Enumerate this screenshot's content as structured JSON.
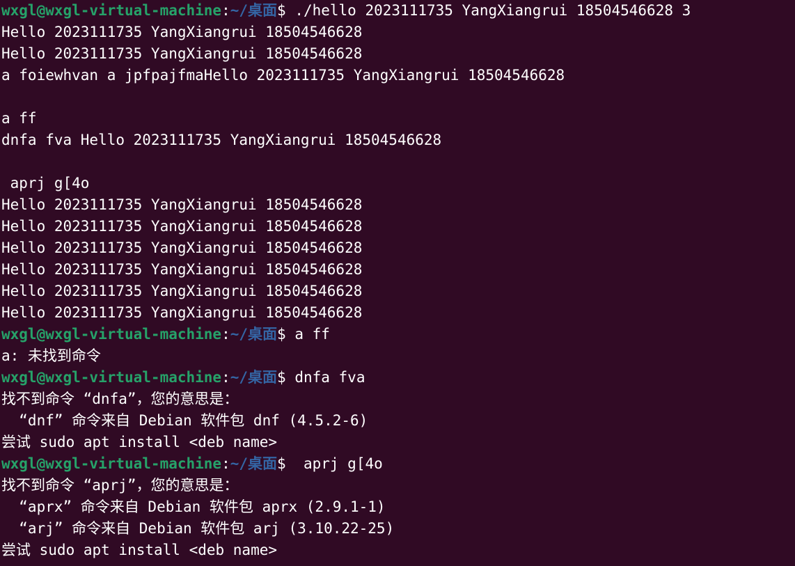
{
  "prompt": {
    "user": "wxgl@wxgl-virtual-machine",
    "colon": ":",
    "path": "~/桌面",
    "dollar": "$ "
  },
  "lines": [
    {
      "type": "prompt",
      "cmd": "./hello 2023111735 YangXiangrui 18504546628 3"
    },
    {
      "type": "out",
      "text": "Hello 2023111735 YangXiangrui 18504546628"
    },
    {
      "type": "out",
      "text": "Hello 2023111735 YangXiangrui 18504546628"
    },
    {
      "type": "out",
      "text": "a foiewhvan a jpfpajfmaHello 2023111735 YangXiangrui 18504546628"
    },
    {
      "type": "out",
      "text": ""
    },
    {
      "type": "out",
      "text": "a ff"
    },
    {
      "type": "out",
      "text": "dnfa fva Hello 2023111735 YangXiangrui 18504546628"
    },
    {
      "type": "out",
      "text": ""
    },
    {
      "type": "out",
      "text": " aprj g[4o"
    },
    {
      "type": "out",
      "text": "Hello 2023111735 YangXiangrui 18504546628"
    },
    {
      "type": "out",
      "text": "Hello 2023111735 YangXiangrui 18504546628"
    },
    {
      "type": "out",
      "text": "Hello 2023111735 YangXiangrui 18504546628"
    },
    {
      "type": "out",
      "text": "Hello 2023111735 YangXiangrui 18504546628"
    },
    {
      "type": "out",
      "text": "Hello 2023111735 YangXiangrui 18504546628"
    },
    {
      "type": "out",
      "text": "Hello 2023111735 YangXiangrui 18504546628"
    },
    {
      "type": "prompt",
      "cmd": "a ff"
    },
    {
      "type": "out",
      "text": "a: 未找到命令"
    },
    {
      "type": "prompt",
      "cmd": "dnfa fva"
    },
    {
      "type": "out",
      "text": "找不到命令 “dnfa”，您的意思是："
    },
    {
      "type": "out",
      "text": "  “dnf” 命令来自 Debian 软件包 dnf (4.5.2-6)"
    },
    {
      "type": "out",
      "text": "尝试 sudo apt install <deb name>"
    },
    {
      "type": "prompt",
      "cmd": " aprj g[4o"
    },
    {
      "type": "out",
      "text": "找不到命令 “aprj”，您的意思是："
    },
    {
      "type": "out",
      "text": "  “aprx” 命令来自 Debian 软件包 aprx (2.9.1-1)"
    },
    {
      "type": "out",
      "text": "  “arj” 命令来自 Debian 软件包 arj (3.10.22-25)"
    },
    {
      "type": "out",
      "text": "尝试 sudo apt install <deb name>"
    },
    {
      "type": "cursor"
    }
  ],
  "colors": {
    "background": "#300a24",
    "user": "#26a269",
    "path": "#3465a4",
    "text": "#ffffff"
  }
}
